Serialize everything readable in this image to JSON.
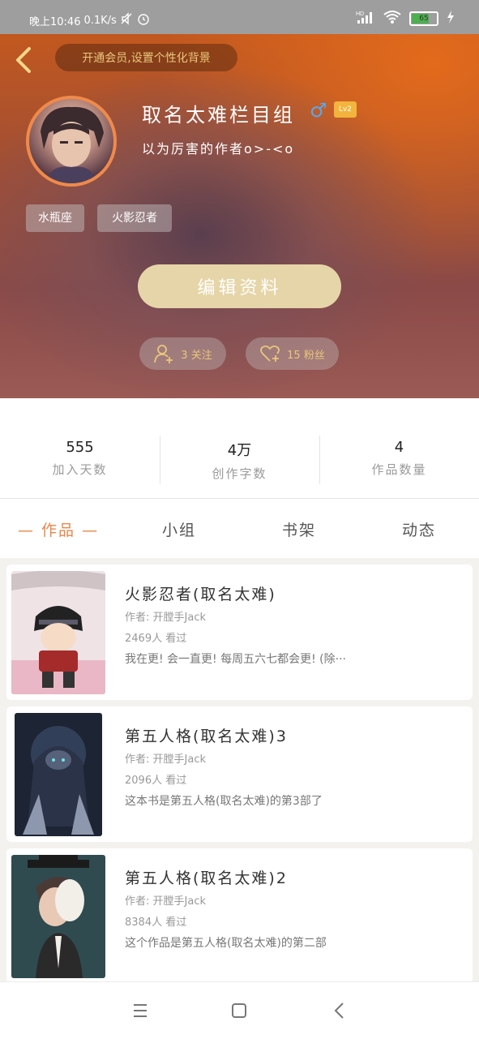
{
  "status_bar": {
    "time": "晚上10:46",
    "speed": "0.1K/s",
    "network": "HD",
    "battery": "65"
  },
  "header": {
    "vip_banner": "开通会员,设置个性化背景",
    "username": "取名太难栏目组",
    "gender_symbol": "♂",
    "level": "Lv2",
    "signature": "以为厉害的作者o>-<o",
    "tags": [
      "水瓶座",
      "火影忍者"
    ],
    "edit_button": "编辑资料",
    "following_label": "3 关注",
    "followers_label": "15 粉丝"
  },
  "stats": [
    {
      "value": "555",
      "label": "加入天数"
    },
    {
      "value": "4万",
      "label": "创作字数"
    },
    {
      "value": "4",
      "label": "作品数量"
    }
  ],
  "tabs": [
    "— 作品 —",
    "小组",
    "书架",
    "动态"
  ],
  "works": [
    {
      "title": "火影忍者(取名太难)",
      "author": "作者: 开膛手Jack",
      "views": "2469人 看过",
      "desc": "我在更! 会一直更! 每周五六七都会更! (除···"
    },
    {
      "title": "第五人格(取名太难)3",
      "author": "作者: 开膛手Jack",
      "views": "2096人 看过",
      "desc": "这本书是第五人格(取名太难)的第3部了"
    },
    {
      "title": "第五人格(取名太难)2",
      "author": "作者: 开膛手Jack",
      "views": "8384人 看过",
      "desc": "这个作品是第五人格(取名太难)的第二部"
    }
  ],
  "colors": {
    "accent": "#e9864a",
    "gold": "#e9c77b",
    "edit_button": "#e6d5a8",
    "level_badge": "#f2b43c",
    "gender": "#5aa7e8"
  }
}
